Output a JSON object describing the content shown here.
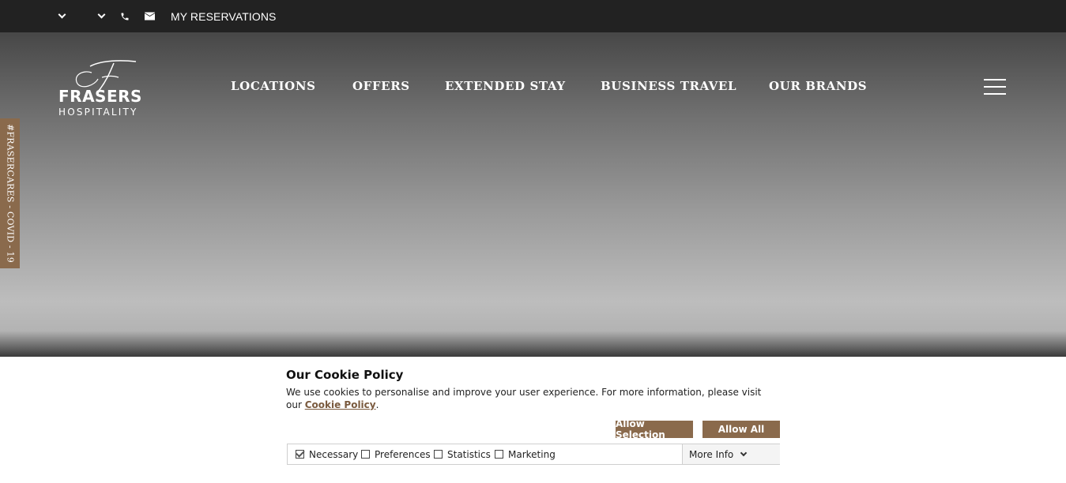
{
  "topbar": {
    "icons": [
      "chevron-down-icon",
      "chevron-down-icon",
      "phone-icon",
      "mail-icon"
    ],
    "reservations_label": "MY RESERVATIONS",
    "background": "#222222"
  },
  "brand": {
    "line1": "FRASERS",
    "line2": "HOSPITALITY",
    "monogram": "F"
  },
  "nav": {
    "items": [
      "LOCATIONS",
      "OFFERS",
      "EXTENDED STAY",
      "BUSINESS TRAVEL",
      "OUR BRANDS"
    ]
  },
  "menu_icon": "hamburger-icon",
  "side_tab": {
    "label": "#FRASERCARES - COVID - 19",
    "color": "#8a6a4c"
  },
  "cookie": {
    "title": "Our Cookie Policy",
    "text": "We use cookies to personalise and improve your user experience. For more information, please visit our ",
    "link": "Cookie Policy",
    "text_end": ".",
    "allow_selection": "Allow Selection",
    "allow_all": "Allow All",
    "options": [
      {
        "label": "Necessary",
        "checked": true
      },
      {
        "label": "Preferences",
        "checked": false
      },
      {
        "label": "Statistics",
        "checked": false
      },
      {
        "label": "Marketing",
        "checked": false
      }
    ],
    "more_info": "More Info",
    "accent": "#8a6a4c"
  }
}
